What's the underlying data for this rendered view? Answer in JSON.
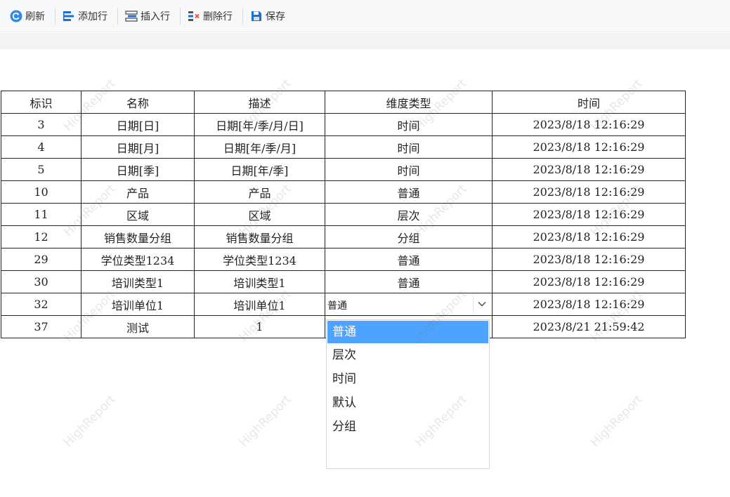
{
  "toolbar": {
    "refresh": "刷新",
    "add_row": "添加行",
    "insert_row": "插入行",
    "delete_row": "删除行",
    "save": "保存"
  },
  "table": {
    "headers": [
      "标识",
      "名称",
      "描述",
      "维度类型",
      "时间"
    ],
    "rows": [
      [
        "3",
        "日期[日]",
        "日期[年/季/月/日]",
        "时间",
        "2023/8/18 12:16:29"
      ],
      [
        "4",
        "日期[月]",
        "日期[年/季/月]",
        "时间",
        "2023/8/18 12:16:29"
      ],
      [
        "5",
        "日期[季]",
        "日期[年/季]",
        "时间",
        "2023/8/18 12:16:29"
      ],
      [
        "10",
        "产品",
        "产品",
        "普通",
        "2023/8/18 12:16:29"
      ],
      [
        "11",
        "区域",
        "区域",
        "层次",
        "2023/8/18 12:16:29"
      ],
      [
        "12",
        "销售数量分组",
        "销售数量分组",
        "分组",
        "2023/8/18 12:16:29"
      ],
      [
        "29",
        "学位类型1234",
        "学位类型1234",
        "普通",
        "2023/8/18 12:16:29"
      ],
      [
        "30",
        "培训类型1",
        "培训类型1",
        "普通",
        "2023/8/18 12:16:29"
      ],
      [
        "32",
        "培训单位1",
        "培训单位1",
        "普通",
        "2023/8/18 12:16:29"
      ],
      [
        "37",
        "测试",
        "1",
        "",
        "2023/8/21 21:59:42"
      ]
    ]
  },
  "dropdown": {
    "options": [
      "普通",
      "层次",
      "时间",
      "默认",
      "分组"
    ],
    "selected_index": 0
  },
  "watermark": "HighReport",
  "colors": {
    "refresh_icon": "#2f8be6",
    "save_icon": "#1f6fd1",
    "delete_x": "#e84a3c",
    "dropdown_selected_bg": "#4da3ff"
  }
}
